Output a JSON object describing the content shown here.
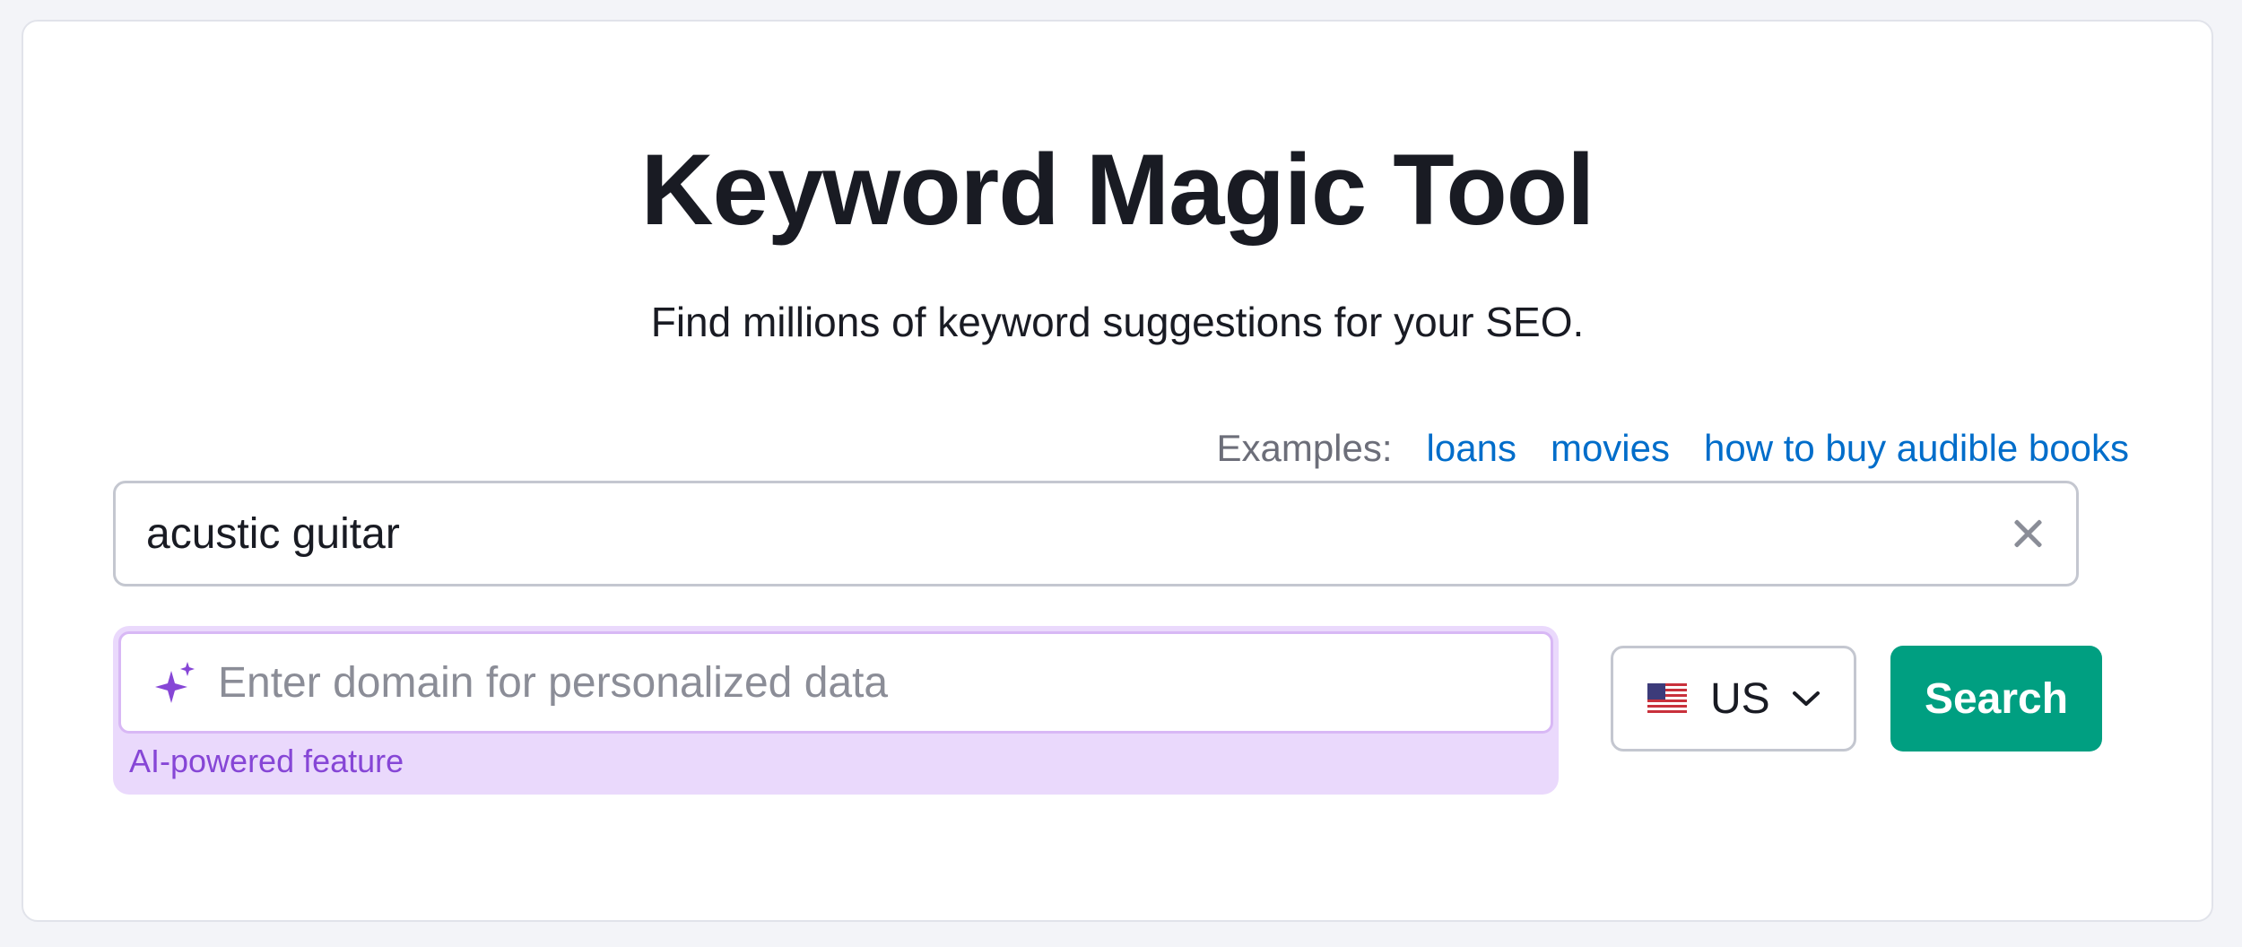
{
  "header": {
    "title": "Keyword Magic Tool",
    "subtitle": "Find millions of keyword suggestions for your SEO."
  },
  "examples": {
    "label": "Examples:",
    "links": [
      "loans",
      "movies",
      "how to buy audible books"
    ]
  },
  "keyword_input": {
    "value": "acustic guitar"
  },
  "domain_input": {
    "placeholder": "Enter domain for personalized data",
    "note": "AI-powered feature"
  },
  "country_select": {
    "value": "US",
    "icon": "us-flag-icon"
  },
  "search_button": {
    "label": "Search"
  },
  "colors": {
    "accent": "#009f81",
    "link": "#006dca",
    "ai": "#8646d6"
  }
}
